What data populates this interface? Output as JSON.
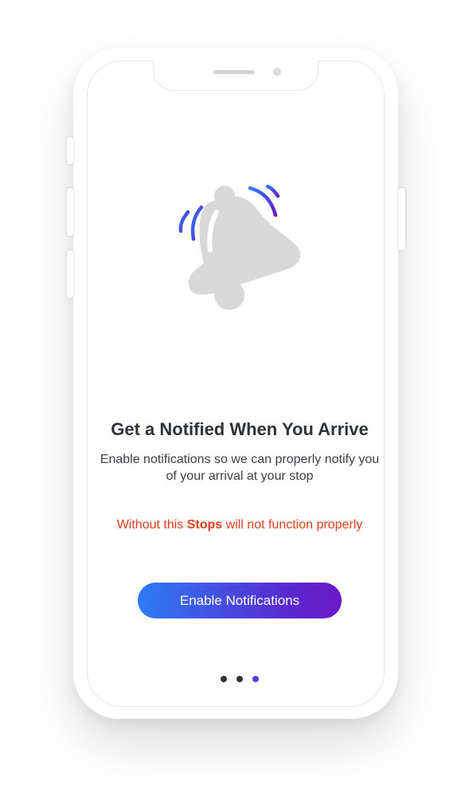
{
  "onboarding": {
    "title": "Get a Notified When You Arrive",
    "subtitle": "Enable notifications so we can properly notify you of your arrival at your stop",
    "warning_prefix": "Without this ",
    "warning_brand": "Stops",
    "warning_suffix": " will not function properly",
    "cta_label": "Enable Notifications",
    "illustration_icon": "bell-icon",
    "page_indicator": {
      "total": 3,
      "current": 3
    }
  },
  "colors": {
    "title": "#2e3338",
    "warning": "#e0401f",
    "cta_gradient_start": "#2d7cf6",
    "cta_gradient_end": "#6a18c6",
    "dot_active": "#5c3ee0",
    "dot_inactive": "#2e3338",
    "bell_fill": "#d8d8d8"
  }
}
